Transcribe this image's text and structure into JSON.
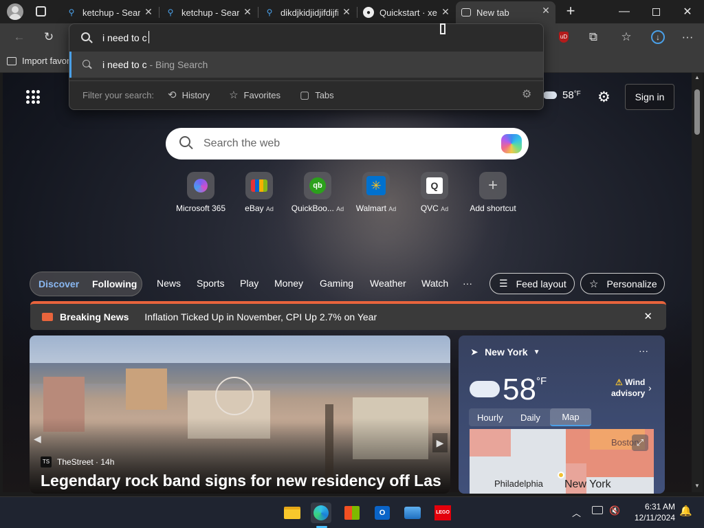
{
  "browser": {
    "tabs": [
      {
        "title": "ketchup - Search",
        "favicon": "bing-search-icon"
      },
      {
        "title": "ketchup - Search",
        "favicon": "bing-search-icon"
      },
      {
        "title": "dikdjkidjidjifdijfi",
        "favicon": "bing-search-icon"
      },
      {
        "title": "Quickstart · xem",
        "favicon": "github-icon"
      },
      {
        "title": "New tab",
        "favicon": "new-tab-icon"
      }
    ],
    "address_value": "i need to c",
    "favorites_bar_label": "Import favor"
  },
  "omnibox": {
    "suggestion_text": "i need to c",
    "suggestion_suffix": " - Bing Search",
    "filter_label": "Filter your search:",
    "filters": [
      "History",
      "Favorites",
      "Tabs"
    ]
  },
  "newtab": {
    "weather_temp": "58",
    "weather_unit": "°F",
    "sign_in_label": "Sign in",
    "search_placeholder": "Search the web",
    "shortcuts": [
      {
        "label": "Microsoft 365",
        "ad": ""
      },
      {
        "label": "eBay",
        "ad": "Ad"
      },
      {
        "label": "QuickBoo...",
        "ad": "Ad"
      },
      {
        "label": "Walmart",
        "ad": "Ad"
      },
      {
        "label": "QVC",
        "ad": "Ad"
      },
      {
        "label": "Add shortcut",
        "ad": ""
      }
    ],
    "nav": {
      "discover": "Discover",
      "following": "Following",
      "items": [
        "News",
        "Sports",
        "Play",
        "Money",
        "Gaming",
        "Weather",
        "Watch"
      ],
      "more": "···",
      "feed_layout": "Feed layout",
      "personalize": "Personalize"
    },
    "breaking": {
      "label": "Breaking News",
      "headline": "Inflation Ticked Up in November, CPI Up 2.7% on Year"
    },
    "news_card": {
      "source": "TheStreet",
      "age": "14h",
      "headline": "Legendary rock band signs for new residency off Las"
    },
    "weather_card": {
      "location": "New York",
      "temp": "58",
      "unit": "°F",
      "alert_line1": "Wind",
      "alert_line2": "advisory",
      "tabs": [
        "Hourly",
        "Daily",
        "Map"
      ],
      "map_labels": [
        "Boston",
        "Philadelphia",
        "New York"
      ]
    }
  },
  "taskbar": {
    "time": "6:31 AM",
    "date": "12/11/2024"
  },
  "colors": {
    "accent": "#4aa0e8",
    "breaking": "#e8643c",
    "chrome_dark": "#202020",
    "toolbar": "#3b3b3b"
  }
}
